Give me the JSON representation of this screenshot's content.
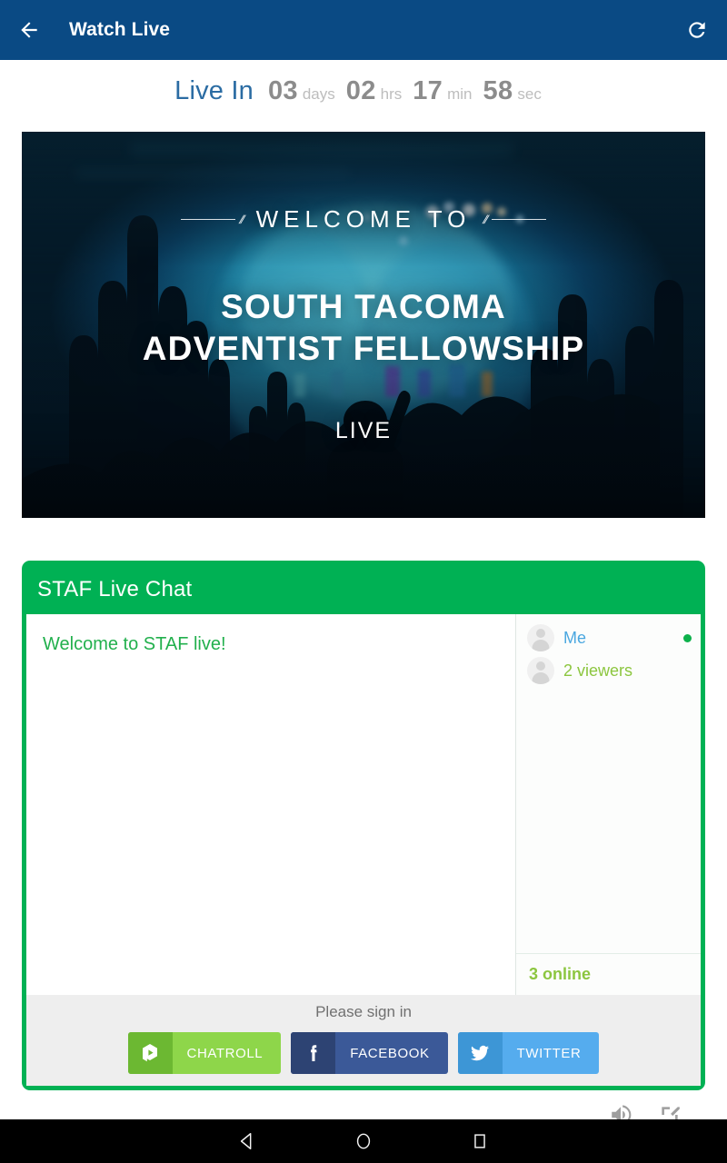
{
  "appbar": {
    "back_icon": "arrow-left-icon",
    "title": "Watch Live",
    "refresh_icon": "refresh-icon"
  },
  "countdown": {
    "label": "Live In",
    "units": [
      {
        "value": "03",
        "suffix": "days"
      },
      {
        "value": "02",
        "suffix": "hrs"
      },
      {
        "value": "17",
        "suffix": "min"
      },
      {
        "value": "58",
        "suffix": "sec"
      }
    ]
  },
  "video": {
    "welcome": "WELCOME TO",
    "name_line1": "SOUTH TACOMA",
    "name_line2": "ADVENTIST FELLOWSHIP",
    "live": "LIVE"
  },
  "chat": {
    "header_title": "STAF Live Chat",
    "messages": [
      {
        "text": "Welcome to STAF live!"
      }
    ],
    "users": [
      {
        "name": "Me",
        "style": "me",
        "online": true
      },
      {
        "name": "2 viewers",
        "style": "viewers",
        "online": false
      }
    ],
    "online_count": "3 online",
    "signin_label": "Please sign in",
    "signin_buttons": [
      {
        "label": "CHATROLL",
        "icon": "chatroll-icon",
        "style": "chatroll"
      },
      {
        "label": "FACEBOOK",
        "icon": "facebook-icon",
        "style": "facebook"
      },
      {
        "label": "TWITTER",
        "icon": "twitter-icon",
        "style": "twitter"
      }
    ]
  },
  "player_controls": [
    {
      "icon": "volume-icon"
    },
    {
      "icon": "fullscreen-icon"
    }
  ],
  "navbar": {
    "buttons": [
      {
        "icon": "back-triangle-icon"
      },
      {
        "icon": "home-circle-icon"
      },
      {
        "icon": "recents-square-icon"
      }
    ]
  },
  "colors": {
    "appbar": "#0a4a84",
    "chat_green": "#00b154",
    "countdown_label": "#2b6ca3",
    "message_green": "#22b04d",
    "viewers_green": "#8cc63f",
    "me_blue": "#4aa7e0",
    "footer_gray": "#eeeeee",
    "facebook": "#3b5998",
    "twitter": "#55acee",
    "chatroll": "#8ed64a"
  }
}
